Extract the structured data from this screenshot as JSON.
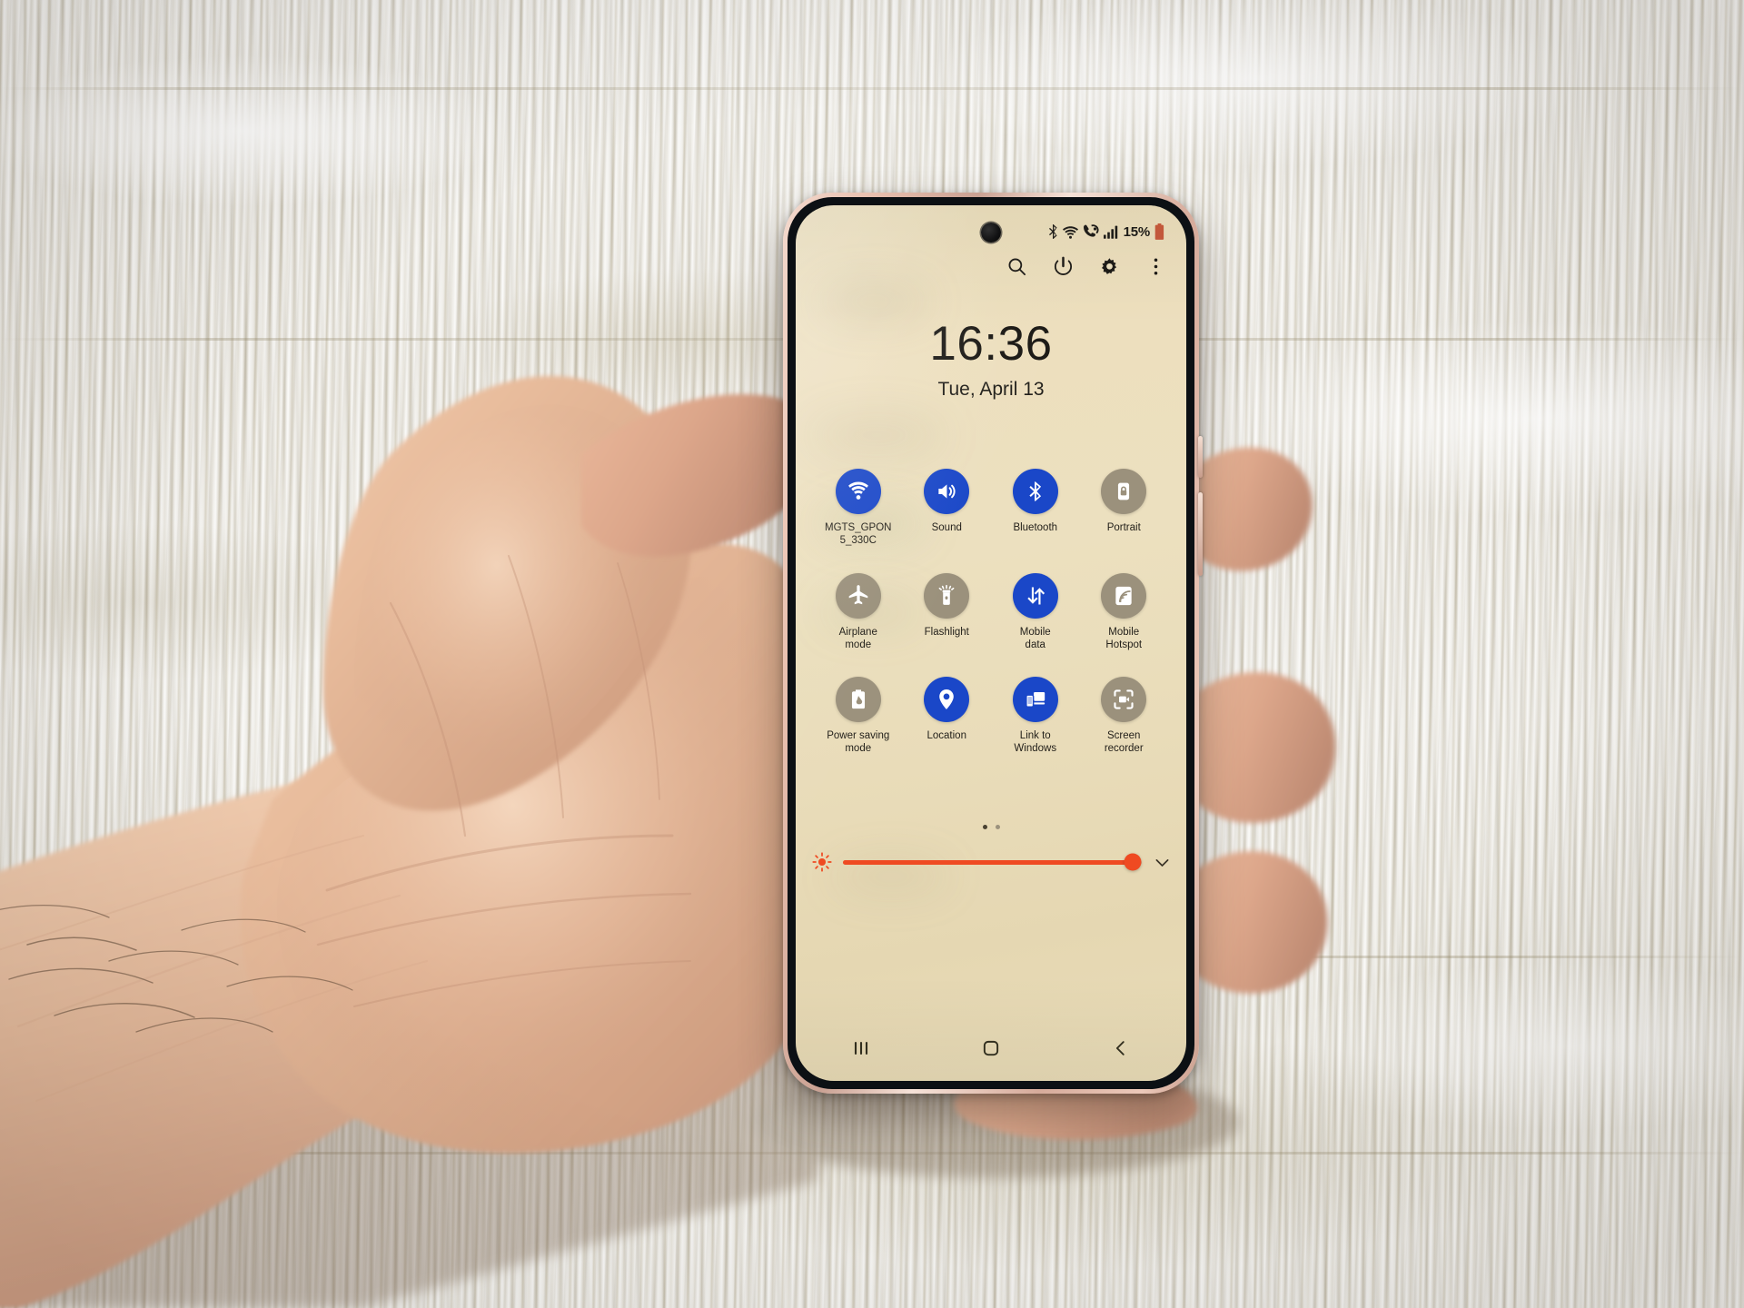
{
  "scene": {
    "description": "hand holding smartphone over whitewashed wood surface",
    "background_color": "#e8e6e0",
    "phone_frame_color": "#e0b8a6",
    "screen_color": "#ead db8"
  },
  "status_bar": {
    "battery_percent": "15%",
    "icons": [
      "bluetooth-icon",
      "wifi-icon",
      "volte-call-icon",
      "signal-bars-icon",
      "battery-icon"
    ],
    "battery_low_color": "#c85a3c"
  },
  "panel_actions": [
    {
      "name": "search-icon",
      "label": "Search"
    },
    {
      "name": "power-icon",
      "label": "Power off"
    },
    {
      "name": "settings-gear-icon",
      "label": "Settings"
    },
    {
      "name": "more-options-icon",
      "label": "More options"
    }
  ],
  "clock": {
    "time": "16:36",
    "date": "Tue, April 13"
  },
  "quick_settings": {
    "accent_on_color": "#1a47c8",
    "accent_off_color": "#9b917c",
    "tiles": [
      {
        "label": "MGTS_GPON\n5_330C",
        "icon": "wifi-icon",
        "state": "on"
      },
      {
        "label": "Sound",
        "icon": "sound-icon",
        "state": "on"
      },
      {
        "label": "Bluetooth",
        "icon": "bluetooth-icon",
        "state": "on"
      },
      {
        "label": "Portrait",
        "icon": "rotation-lock-icon",
        "state": "off"
      },
      {
        "label": "Airplane\nmode",
        "icon": "airplane-icon",
        "state": "off"
      },
      {
        "label": "Flashlight",
        "icon": "flashlight-icon",
        "state": "off"
      },
      {
        "label": "Mobile\ndata",
        "icon": "mobile-data-icon",
        "state": "on"
      },
      {
        "label": "Mobile\nHotspot",
        "icon": "hotspot-icon",
        "state": "off"
      },
      {
        "label": "Power saving\nmode",
        "icon": "power-saving-icon",
        "state": "off"
      },
      {
        "label": "Location",
        "icon": "location-pin-icon",
        "state": "on"
      },
      {
        "label": "Link to\nWindows",
        "icon": "link-to-windows-icon",
        "state": "on"
      },
      {
        "label": "Screen\nrecorder",
        "icon": "screen-recorder-icon",
        "state": "off"
      }
    ]
  },
  "page_indicator": {
    "total": 2,
    "active": 1
  },
  "brightness": {
    "value_percent": 97,
    "track_color": "#ef4a22",
    "left_icon": "brightness-sun-icon",
    "right_icon": "chevron-down-icon"
  },
  "nav_bar": {
    "buttons": [
      {
        "name": "recents-button",
        "icon": "recents-icon",
        "label": "Recents"
      },
      {
        "name": "home-button",
        "icon": "home-icon",
        "label": "Home"
      },
      {
        "name": "back-button",
        "icon": "back-icon",
        "label": "Back"
      }
    ]
  }
}
